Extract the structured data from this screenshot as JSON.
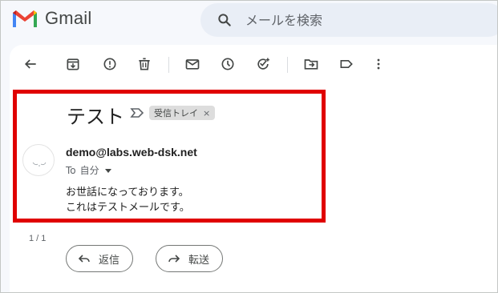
{
  "app": {
    "name": "Gmail"
  },
  "search": {
    "placeholder": "メールを検索"
  },
  "toolbar": {
    "icons": [
      "back-icon",
      "archive-icon",
      "report-spam-icon",
      "delete-icon",
      "mark-unread-icon",
      "snooze-icon",
      "add-task-icon",
      "move-to-icon",
      "label-icon",
      "more-icon"
    ]
  },
  "email": {
    "subject": "テスト",
    "label": "受信トレイ",
    "label_close": "×",
    "sender": "demo@labs.web-dsk.net",
    "recipient_prefix": "To",
    "recipient": "自分",
    "body_line1": "お世話になっております。",
    "body_line2": "これはテストメールです。",
    "counter": "1 / 1"
  },
  "actions": {
    "reply": "返信",
    "forward": "転送"
  },
  "colors": {
    "highlight": "#e00000",
    "gmail_red": "#ea4335",
    "gmail_blue": "#4285f4",
    "gmail_green": "#34a853",
    "gmail_yellow": "#fbbc04"
  }
}
